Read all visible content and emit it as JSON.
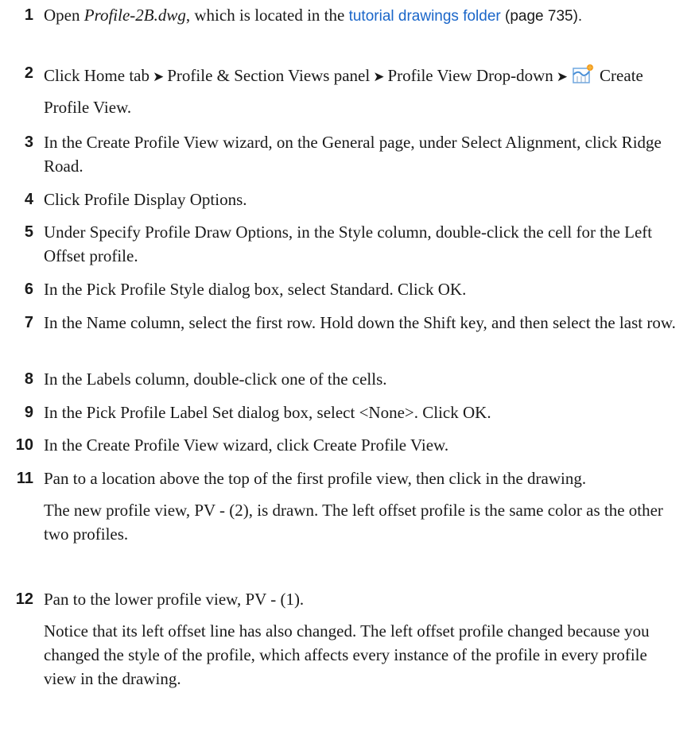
{
  "steps": [
    {
      "number": "1",
      "text_before": "Open ",
      "file_name": "Profile-2B.dwg",
      "text_after": ", which is located in the ",
      "link_text": "tutorial drawings folder",
      "page_ref": " (page 735)."
    },
    {
      "number": "2",
      "path": [
        "Click Home tab",
        "Profile & Section Views panel",
        "Profile View Drop-down"
      ],
      "separator": "➤",
      "icon": "create-profile-view-icon",
      "command": "Create Profile View."
    },
    {
      "number": "3",
      "text": "In the Create Profile View wizard, on the General page, under Select Alignment, click Ridge Road."
    },
    {
      "number": "4",
      "text": "Click Profile Display Options."
    },
    {
      "number": "5",
      "text": "Under Specify Profile Draw Options, in the Style column, double-click the cell for the Left Offset profile."
    },
    {
      "number": "6",
      "text": "In the Pick Profile Style dialog box, select Standard. Click OK."
    },
    {
      "number": "7",
      "text": "In the Name column, select the first row. Hold down the Shift key, and then select the last row."
    },
    {
      "number": "8",
      "text": "In the Labels column, double-click one of the cells."
    },
    {
      "number": "9",
      "text": "In the Pick Profile Label Set dialog box, select <None>. Click OK."
    },
    {
      "number": "10",
      "text": "In the Create Profile View wizard, click Create Profile View."
    },
    {
      "number": "11",
      "text": "Pan to a location above the top of the first profile view, then click in the drawing.",
      "note": "The new profile view, PV - (2), is drawn. The left offset profile is the same color as the other two profiles."
    },
    {
      "number": "12",
      "text": "Pan to the lower profile view, PV - (1).",
      "note": "Notice that its left offset line has also changed. The left offset profile changed because you changed the style of the profile, which affects every instance of the profile in every profile view in the drawing."
    }
  ],
  "colors": {
    "link": "#1a66c9",
    "text": "#1a1a1a",
    "icon_blue": "#4a8fd6",
    "icon_orange": "#f29a1e"
  }
}
